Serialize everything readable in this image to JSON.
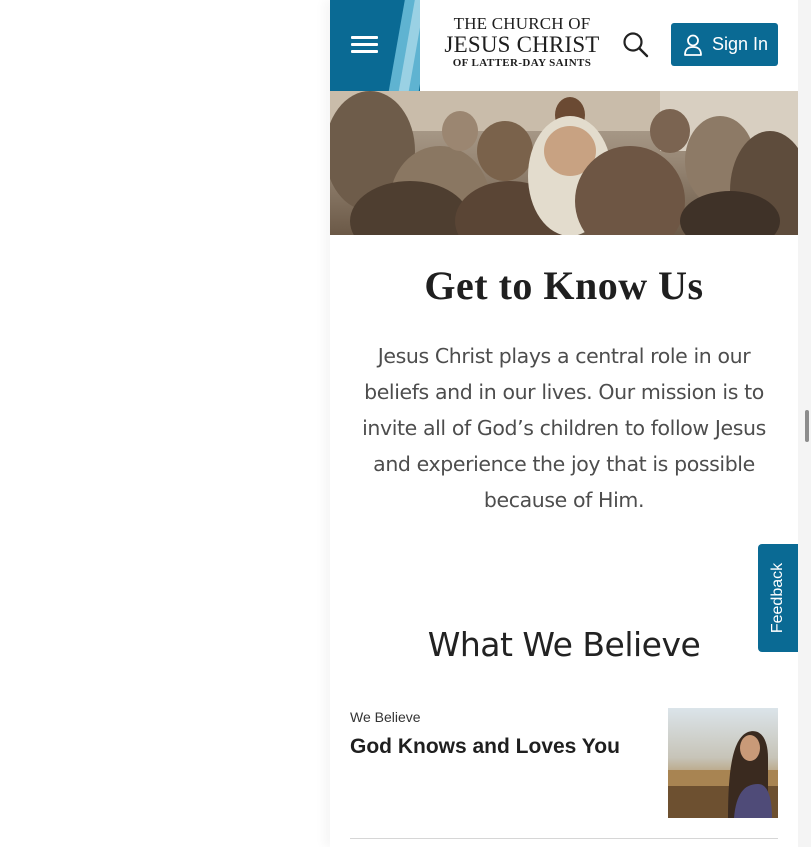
{
  "header": {
    "logo": {
      "line1": "THE CHURCH OF",
      "line2": "JESUS CHRIST",
      "line3": "OF LATTER-DAY SAINTS"
    },
    "menu_icon": "hamburger-menu-icon",
    "search_icon": "search-icon",
    "sign_in_label": "Sign In",
    "sign_in_icon": "user-icon"
  },
  "main": {
    "title": "Get to Know Us",
    "intro": "Jesus Christ plays a central role in our beliefs and in our lives. Our mission is to invite all of God’s children to follow Jesus and experience the joy that is possible because of Him."
  },
  "believe": {
    "section_title": "What We Believe",
    "cards": [
      {
        "eyebrow": "We Believe",
        "title": "God Knows and Loves You"
      }
    ]
  },
  "feedback_label": "Feedback",
  "colors": {
    "brand_blue": "#0a6a94",
    "accent_light_blue": "#5fb3d1",
    "text_dark": "#1f1f1f"
  }
}
